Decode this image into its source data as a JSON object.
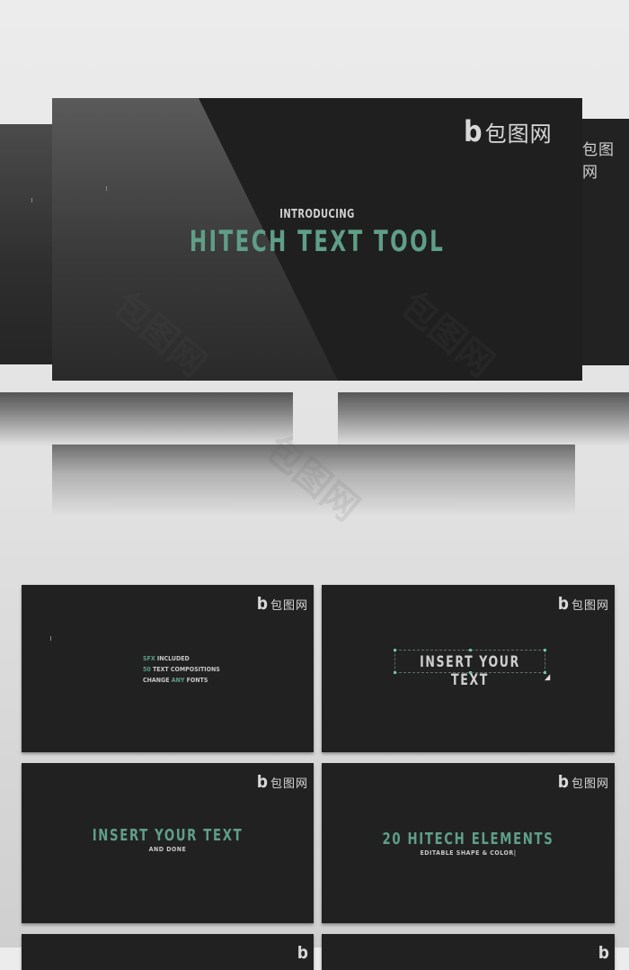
{
  "brand": {
    "logo_glyph": "b",
    "logo_text": "包图网",
    "accent_color": "#5f9e87"
  },
  "hero": {
    "kicker": "INTRODUCING",
    "title": "HITECH TEXT TOOL"
  },
  "panels": [
    {
      "lines": [
        {
          "accent": "SFX",
          "rest": " INCLUDED"
        },
        {
          "accent": "50",
          "rest": " TEXT COMPOSITIONS"
        },
        {
          "prefix": "CHANGE ",
          "accent": "ANY",
          "rest": " FONTS"
        }
      ]
    },
    {
      "title": "INSERT YOUR TEXT"
    },
    {
      "title": "INSERT YOUR TEXT",
      "subtitle": "AND DONE"
    },
    {
      "title": "20 HITECH ELEMENTS",
      "subtitle": "EDITABLE SHAPE & COLOR|"
    }
  ],
  "watermark": "包图网"
}
